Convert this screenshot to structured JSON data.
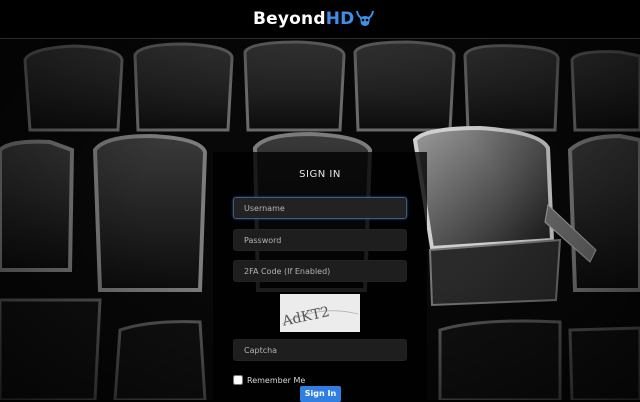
{
  "header": {
    "logo_text_main": "Beyond",
    "logo_text_accent": "HD",
    "logo_icon": "horned-skull-icon",
    "accent_color": "#3d8fe8"
  },
  "form": {
    "title": "SIGN IN",
    "username_placeholder": "Username",
    "password_placeholder": "Password",
    "twofa_placeholder": "2FA Code (If Enabled)",
    "captcha_text": "AdKT2",
    "captcha_placeholder": "Captcha",
    "remember_label": "Remember Me",
    "submit_label": "Sign In",
    "button_color": "#2f7ee0"
  }
}
